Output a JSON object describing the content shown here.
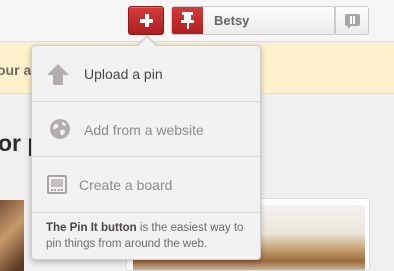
{
  "header": {
    "add_button_icon": "plus-icon",
    "pin_icon": "pushpin-icon",
    "user_name": "Betsy",
    "notifications_icon": "notifications-icon"
  },
  "background": {
    "banner_text": "our a",
    "section_heading": "or p"
  },
  "menu": {
    "items": [
      {
        "label": "Upload a pin",
        "icon": "upload-arrow-icon"
      },
      {
        "label": "Add from a website",
        "icon": "globe-icon"
      },
      {
        "label": "Create a board",
        "icon": "board-icon"
      }
    ],
    "footer_bold": "The Pin It button",
    "footer_rest": " is the easiest way to pin things from around the web."
  },
  "colors": {
    "brand_red": "#c1272d",
    "menu_bg": "#f3f2f2",
    "banner_bg": "#fcf1cb"
  }
}
